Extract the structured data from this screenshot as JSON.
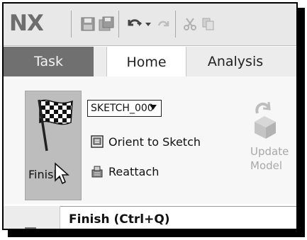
{
  "app": {
    "logo": "NX"
  },
  "quick_access": {
    "icons": [
      "save-icon",
      "save-all-icon",
      "undo-icon",
      "dropdown-arrow-icon",
      "redo-icon",
      "cut-icon",
      "copy-icon"
    ]
  },
  "tabs": [
    {
      "label": "Task"
    },
    {
      "label": "Home"
    },
    {
      "label": "Analysis"
    }
  ],
  "ribbon": {
    "finish_label": "Finish",
    "sketch_select": "SKETCH_000",
    "orient_label": "Orient to Sketch",
    "reattach_label": "Reattach",
    "update_label_1": "Update",
    "update_label_2": "Model"
  },
  "tooltip": {
    "text": "Finish (Ctrl+Q)"
  },
  "colors": {
    "task_tab": "#707070",
    "finish_button": "#bdbdbd",
    "disabled_text": "#a8a8a8"
  }
}
